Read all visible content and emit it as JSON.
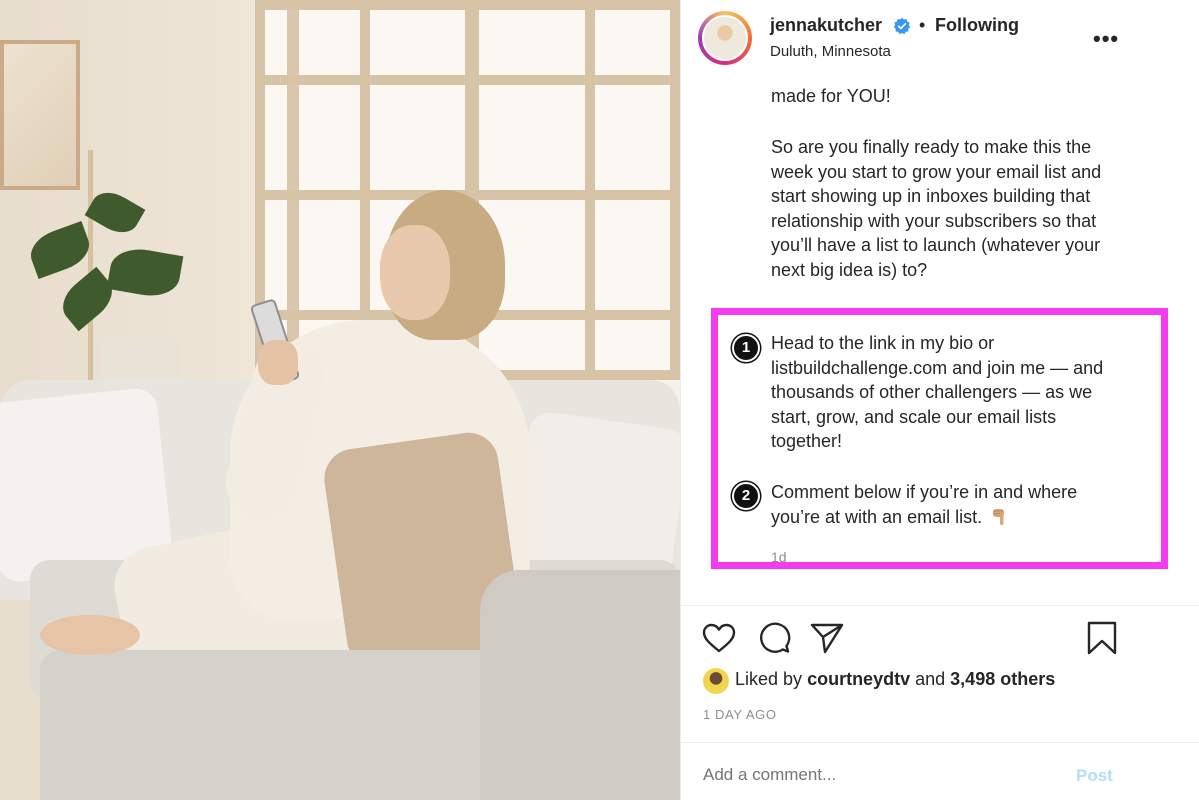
{
  "post": {
    "username": "jennakutcher",
    "separator": "•",
    "follow_status": "Following",
    "location": "Duluth, Minnesota",
    "more_label": "•••"
  },
  "caption": {
    "line_a": "made for YOU!",
    "line_b": "So are you finally ready to make this the week you start to grow your email list and start showing up in inboxes building that relationship with your subscribers so that you’ll have a list to launch (whatever your next big idea is) to?",
    "steps": [
      {
        "number": "1",
        "text": "Head to the link in my bio or listbuildchallenge.com and join me — and thousands of other challengers — as we start, grow, and scale our email lists together!"
      },
      {
        "number": "2",
        "text": "Comment below if you’re in and where you’re at with an email list."
      }
    ],
    "time_ago": "1d"
  },
  "likes": {
    "prefix": "Liked by",
    "user": "courtneydtv",
    "joiner": "and",
    "others": "3,498 others"
  },
  "date": "1 DAY AGO",
  "comment": {
    "placeholder": "Add a comment...",
    "post_label": "Post"
  },
  "colors": {
    "highlight": "#f43bf0",
    "verified": "#3897f0",
    "post_disabled": "#b2dffc",
    "text": "#262626",
    "muted": "#8e8e8e"
  },
  "icons": {
    "like": "heart-icon",
    "comment": "comment-icon",
    "share": "paper-plane-icon",
    "save": "bookmark-icon",
    "verified": "verified-badge-icon",
    "emoji": "pointing-down-hand-emoji"
  }
}
